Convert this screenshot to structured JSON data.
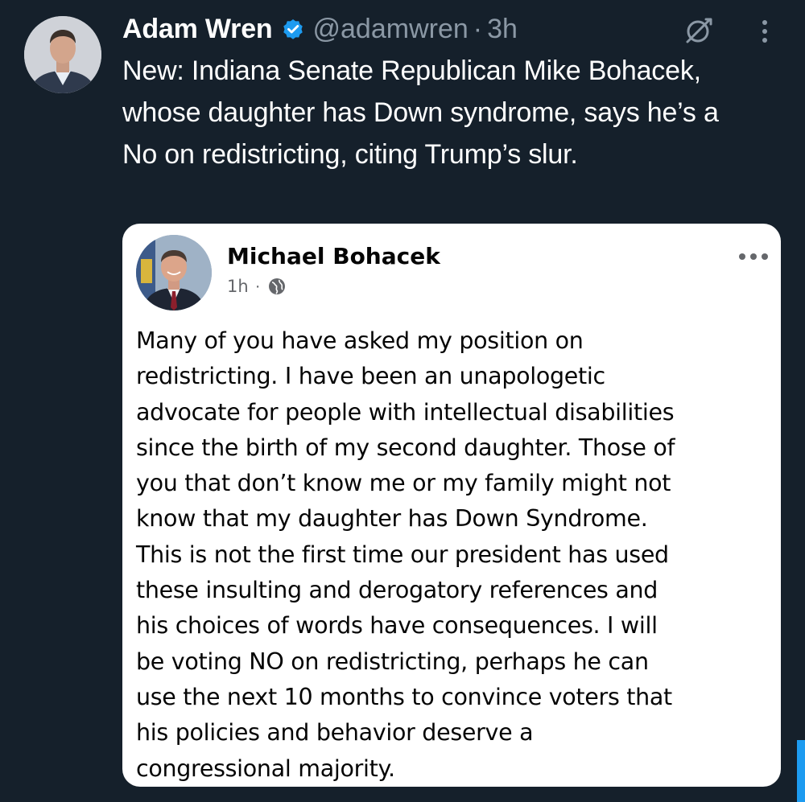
{
  "tweet": {
    "author_name": "Adam Wren",
    "handle": "@adamwren",
    "separator": "·",
    "time": "3h",
    "text": "New: Indiana Senate Republican Mike Bohacek, whose daughter has Down syndrome, says he’s a No on redistricting, citing Trump’s slur.",
    "icons": {
      "verified": "verified-badge-icon",
      "grok": "grok-icon",
      "more": "more-vertical-icon"
    }
  },
  "embedded_post": {
    "author_name": "Michael Bohacek",
    "time": "1h",
    "separator": "·",
    "icons": {
      "audience": "globe-icon",
      "more": "more-horizontal-icon"
    },
    "lines": [
      "Many of you have asked my position on",
      "redistricting.  I have been an unapologetic",
      "advocate for people with intellectual disabilities",
      "since the birth of my second daughter.  Those of",
      "you that don’t know me or my family might not",
      "know that my daughter has Down Syndrome.",
      "This is not the first time our president has used",
      "these insulting and derogatory references and",
      "his choices of words have consequences.  I will",
      "be voting NO on redistricting, perhaps he can",
      "use the next 10 months to convince voters that",
      "his policies and behavior deserve a",
      "congressional majority."
    ]
  },
  "colors": {
    "background": "#15202b",
    "muted_text": "#8b98a5",
    "verified_blue": "#1d9bf0",
    "card_background": "#ffffff",
    "card_text": "#050505",
    "card_muted": "#65676b"
  }
}
